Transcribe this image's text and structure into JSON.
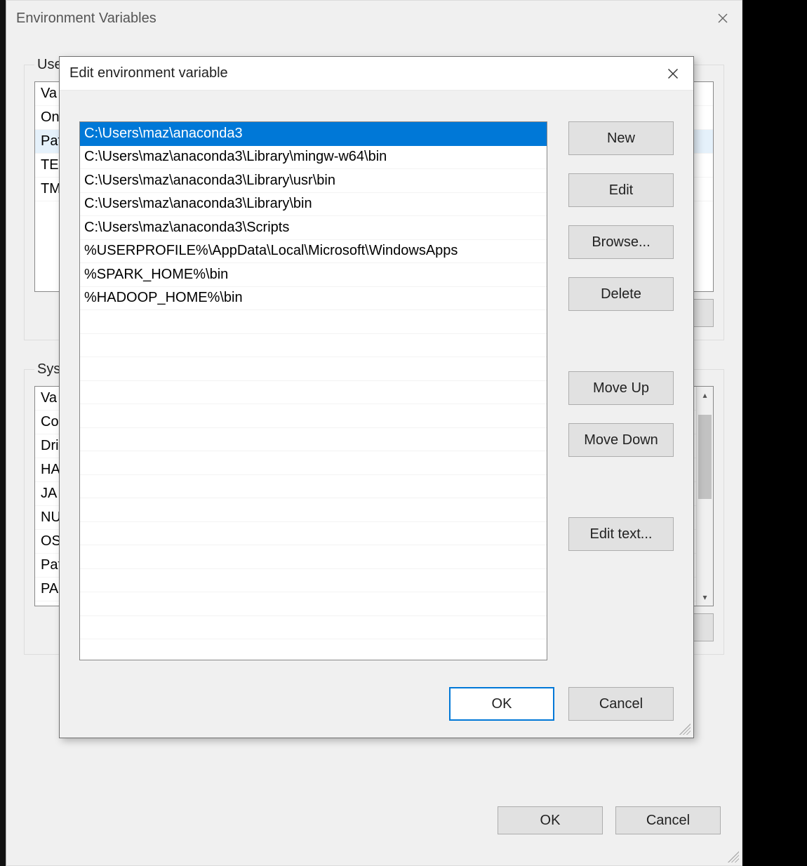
{
  "parent_dialog": {
    "title": "Environment Variables",
    "user_group_label": "User",
    "system_group_label": "Syste",
    "user_vars_visible": [
      "Va",
      "On",
      "Pat",
      "TE",
      "TM"
    ],
    "system_vars_visible": [
      "Va",
      "Co",
      "Dri",
      "HA",
      "JA",
      "NU",
      "OS",
      "Pat",
      "PA"
    ],
    "ok_label": "OK",
    "cancel_label": "Cancel"
  },
  "child_dialog": {
    "title": "Edit environment variable",
    "path_entries": [
      "C:\\Users\\maz\\anaconda3",
      "C:\\Users\\maz\\anaconda3\\Library\\mingw-w64\\bin",
      "C:\\Users\\maz\\anaconda3\\Library\\usr\\bin",
      "C:\\Users\\maz\\anaconda3\\Library\\bin",
      "C:\\Users\\maz\\anaconda3\\Scripts",
      "%USERPROFILE%\\AppData\\Local\\Microsoft\\WindowsApps",
      "%SPARK_HOME%\\bin",
      "%HADOOP_HOME%\\bin"
    ],
    "selected_index": 0,
    "buttons": {
      "new": "New",
      "edit": "Edit",
      "browse": "Browse...",
      "delete": "Delete",
      "move_up": "Move Up",
      "move_down": "Move Down",
      "edit_text": "Edit text...",
      "ok": "OK",
      "cancel": "Cancel"
    }
  }
}
